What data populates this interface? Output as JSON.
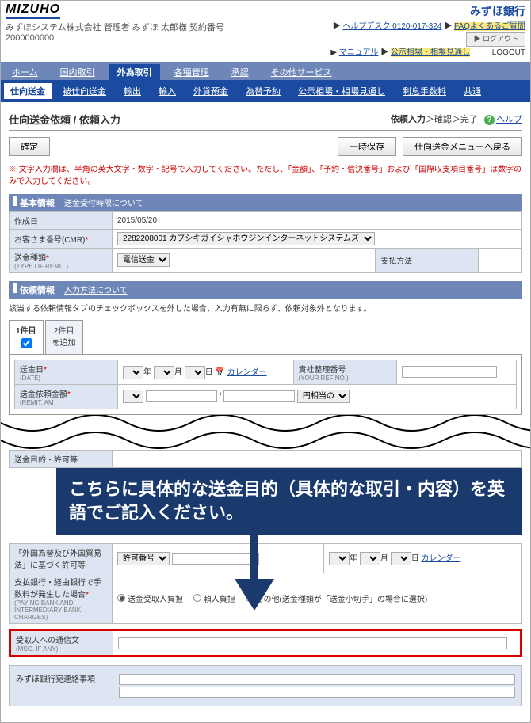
{
  "header": {
    "logo": "MIZUHO",
    "bank_name": "みずほ銀行",
    "company_line": "みずほシステム株式会社  管理者  みずほ 太郎様  契約番号2000000000",
    "help_desk": "ヘルプデスク 0120-017-324",
    "faq": "FAQよくあるご質問",
    "manual": "マニュアル",
    "public_notice": "公示相場・相場見通し",
    "logout": "ログアウト"
  },
  "nav1": {
    "items": [
      "ホーム",
      "国内取引",
      "外為取引",
      "各種管理",
      "承認",
      "その他サービス"
    ],
    "active": 2
  },
  "nav2": {
    "items": [
      "仕向送金",
      "被仕向送金",
      "輸出",
      "輸入",
      "外貨預金",
      "為替予約",
      "公示相場・相場見通し",
      "利息手数料",
      "共通"
    ],
    "active": 0
  },
  "page": {
    "title": "仕向送金依頼 / 依頼入力",
    "crumb_current": "依頼入力",
    "crumb_rest": "＞確認＞完了",
    "help": "ヘルプ"
  },
  "buttons": {
    "confirm": "確定",
    "save": "一時保存",
    "back": "仕向送金メニューへ戻る"
  },
  "note": "※ 文字入力欄は、半角の英大文字・数字・記号で入力してください。ただし、「金額」、「予約・信決番号」および「国際収支項目番号」は数字のみで入力してください。",
  "basic": {
    "head": "基本情報",
    "link": "送金受付時限について",
    "rows": {
      "created_lbl": "作成日",
      "created_val": "2015/05/20",
      "cust_lbl": "お客さま番号(CMR)",
      "cust_sel": "2282208001 カブシキガイシャホウジンインターネットシステムズ",
      "type_lbl": "送金種類",
      "type_sub": "(TYPE OF REMIT.)",
      "type_sel": "電信送金",
      "pay_lbl": "支払方法"
    }
  },
  "req": {
    "head": "依頼情報",
    "link": "入力方法について",
    "note": "該当する依頼情報タブのチェックボックスを外した場合、入力有無に限らず、依頼対象外となります。",
    "tab1": "1件目",
    "tab2": "2件目\nを追加",
    "date_lbl": "送金日",
    "date_sub": "(DATE)",
    "year": "年",
    "month": "月",
    "day": "日",
    "cal": "カレンダー",
    "ref_lbl": "貴社整理番号",
    "ref_sub": "(YOUR REF NO.)",
    "amt_lbl": "送金依頼金額",
    "amt_sub": "(REMIT. AM",
    "cur_sel": "円相当の"
  },
  "callout": "こちらに具体的な送金目的（具体的な取引・内容）を英語でご記入ください。",
  "lower": {
    "permit_lbl": "「外国為替及び外国貿易法」に基づく許可等",
    "permit_sel": "許可番号",
    "charges_lbl": "支払銀行・経由銀行で手数料が発生した場合",
    "charges_sub": "(PAYING BANK AND INTERMEDIARY BANK CHARGES)",
    "r1": "送金受取人負担",
    "r2": "頼人負担",
    "r3": "その他(送金種類が「送金小切手」の場合に選択)",
    "msg_lbl": "受取人への通信文",
    "msg_sub": "(MSG. IF ANY)",
    "mizuho_lbl": "みずほ銀行宛連絡事項"
  }
}
